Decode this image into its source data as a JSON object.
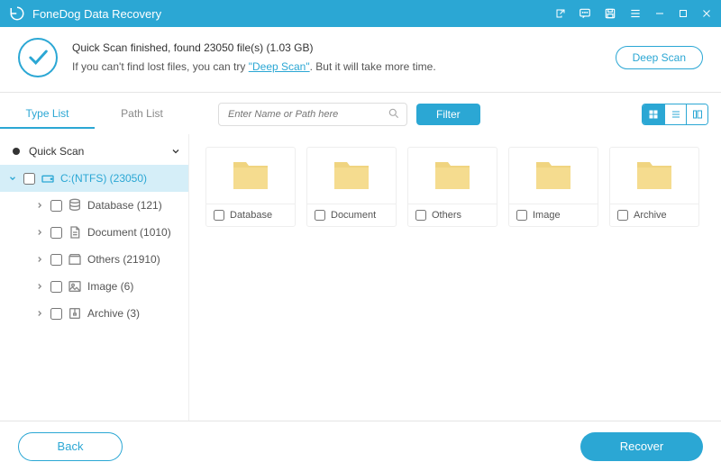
{
  "app": {
    "title": "FoneDog Data Recovery"
  },
  "banner": {
    "line1": "Quick Scan finished, found 23050 file(s) (1.03 GB)",
    "line2_pre": "If you can't find lost files, you can try ",
    "deep_link": "\"Deep Scan\"",
    "line2_post": ". But it will take more time.",
    "deep_scan_btn": "Deep Scan"
  },
  "tabs": {
    "type": "Type List",
    "path": "Path List"
  },
  "search": {
    "placeholder": "Enter Name or Path here"
  },
  "filter_btn": "Filter",
  "tree": {
    "root": "Quick Scan",
    "drive": "C:(NTFS) (23050)",
    "children": [
      {
        "label": "Database (121)",
        "icon": "database"
      },
      {
        "label": "Document (1010)",
        "icon": "document"
      },
      {
        "label": "Others (21910)",
        "icon": "others"
      },
      {
        "label": "Image (6)",
        "icon": "image"
      },
      {
        "label": "Archive (3)",
        "icon": "archive"
      }
    ]
  },
  "folders": [
    {
      "label": "Database"
    },
    {
      "label": "Document"
    },
    {
      "label": "Others"
    },
    {
      "label": "Image"
    },
    {
      "label": "Archive"
    }
  ],
  "footer": {
    "back": "Back",
    "recover": "Recover"
  }
}
